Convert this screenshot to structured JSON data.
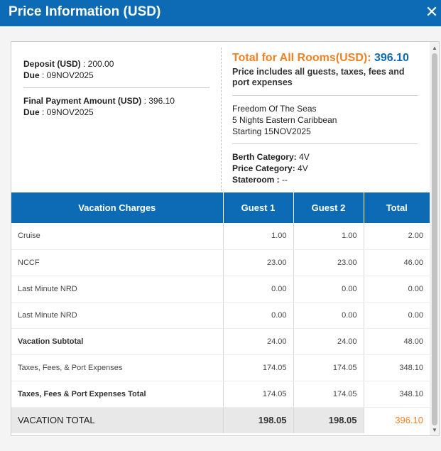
{
  "header": {
    "title": "Price Information (USD)",
    "close_symbol": "✕"
  },
  "summary": {
    "deposit_label": "Deposit (USD)",
    "deposit_value": ": 200.00",
    "deposit_due_label": "Due",
    "deposit_due_value": ": 09NOV2025",
    "final_label": "Final Payment Amount (USD)",
    "final_value": ": 396.10",
    "final_due_label": "Due",
    "final_due_value": ": 09NOV2025",
    "total_label": "Total for All Rooms(USD):",
    "total_value": "396.10",
    "price_includes": "Price includes all guests, taxes, fees and port expenses",
    "ship": "Freedom Of The Seas",
    "itinerary": "5 Nights Eastern Caribbean",
    "starting": "Starting 15NOV2025",
    "berth_label": "Berth Category:",
    "berth_value": "4V",
    "price_cat_label": "Price Category:",
    "price_cat_value": "4V",
    "stateroom_label": "Stateroom :",
    "stateroom_value": "--"
  },
  "table": {
    "headers": [
      "Vacation Charges",
      "Guest 1",
      "Guest 2",
      "Total"
    ],
    "rows": [
      [
        "Cruise",
        "1.00",
        "1.00",
        "2.00"
      ],
      [
        "NCCF",
        "23.00",
        "23.00",
        "46.00"
      ],
      [
        "Last Minute NRD",
        "0.00",
        "0.00",
        "0.00"
      ],
      [
        "Last Minute NRD",
        "0.00",
        "0.00",
        "0.00"
      ],
      [
        "Vacation Subtotal",
        "24.00",
        "24.00",
        "48.00"
      ],
      [
        "Taxes, Fees, & Port Expenses",
        "174.05",
        "174.05",
        "348.10"
      ],
      [
        "Taxes, Fees & Port Expenses Total",
        "174.05",
        "174.05",
        "348.10"
      ]
    ],
    "total_row": [
      "VACATION TOTAL",
      "198.05",
      "198.05",
      "396.10"
    ]
  },
  "icons": {
    "scroll_up": "▲",
    "scroll_down": "▼"
  },
  "colors": {
    "header_bg": "#0c6bb4",
    "accent_orange": "#f08223",
    "total_blue": "#0c6bb4"
  }
}
